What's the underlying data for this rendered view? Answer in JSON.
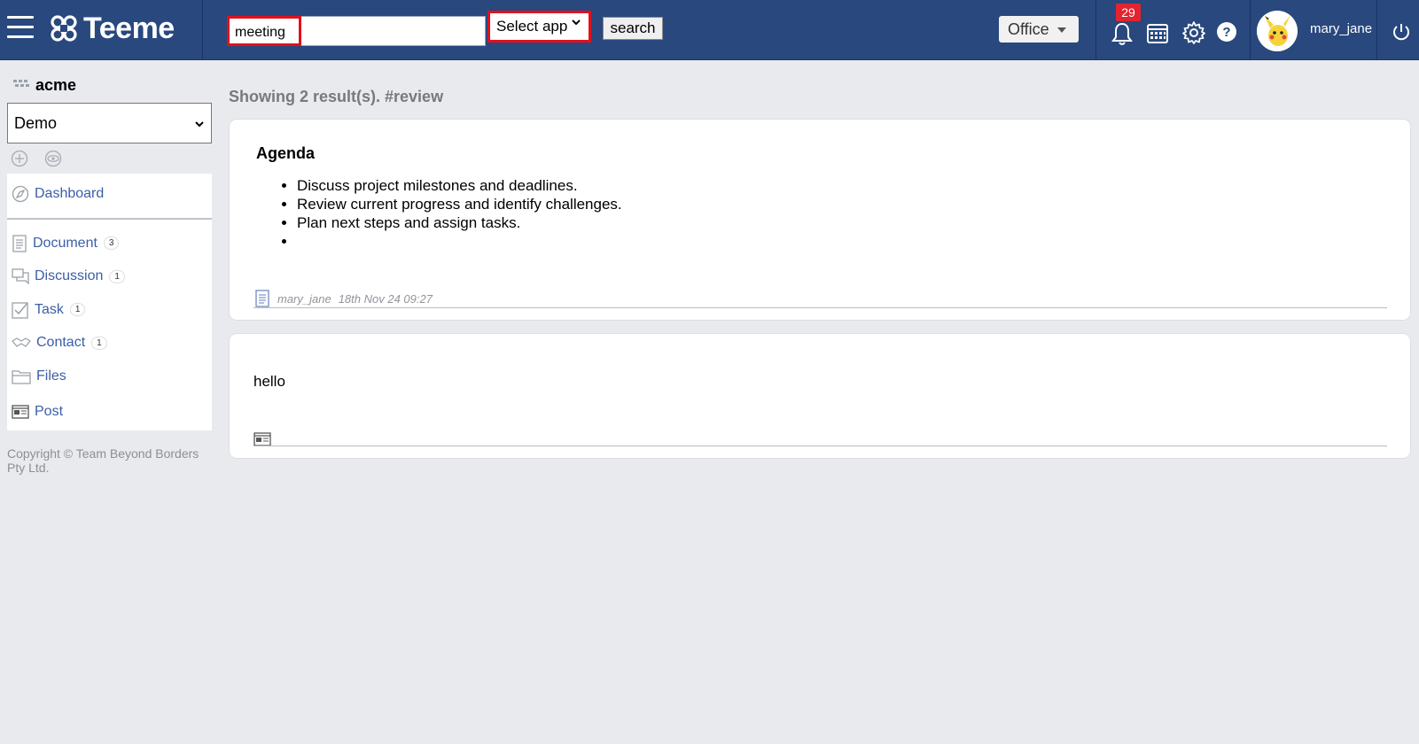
{
  "header": {
    "brand": "Teeme",
    "search": {
      "tag": "meeting",
      "query": "",
      "placeholder": ""
    },
    "app_select": {
      "selected": "Select app"
    },
    "search_button": "search",
    "office_menu": "Office",
    "notifications_count": "29",
    "username": "mary_jane"
  },
  "sidebar": {
    "org_name": "acme",
    "workspace": "Demo",
    "dashboard": "Dashboard",
    "items": [
      {
        "label": "Document",
        "count": "3",
        "icon": "document-icon"
      },
      {
        "label": "Discussion",
        "count": "1",
        "icon": "discussion-icon"
      },
      {
        "label": "Task",
        "count": "1",
        "icon": "task-icon"
      },
      {
        "label": "Contact",
        "count": "1",
        "icon": "contact-icon"
      },
      {
        "label": "Files",
        "count": "",
        "icon": "folder-icon"
      },
      {
        "label": "Post",
        "count": "",
        "icon": "post-icon"
      }
    ],
    "copyright": "Copyright © Team Beyond Borders Pty Ltd."
  },
  "main": {
    "results_title": "Showing 2 result(s). #review",
    "results": [
      {
        "title": "Agenda",
        "bullets": [
          "Discuss project milestones and deadlines.",
          "Review current progress and identify challenges.",
          "Plan next steps and assign tasks.",
          ""
        ],
        "author": "mary_jane",
        "date": "18th Nov 24 09:27",
        "type_icon": "document-icon"
      },
      {
        "text": "hello",
        "type_icon": "post-icon"
      }
    ]
  },
  "colors": {
    "header_bg": "#28487e",
    "highlight_border": "#e3101a",
    "link": "#3b5ea8",
    "badge": "#e5232e"
  }
}
